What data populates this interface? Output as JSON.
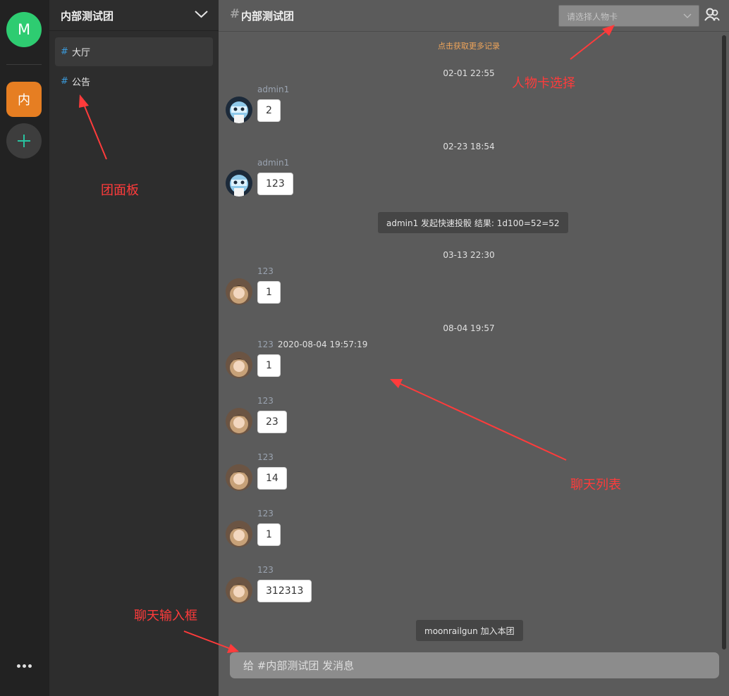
{
  "rail": {
    "user_initial": "M",
    "group_initial": "内",
    "colors": {
      "user": "#2ecc71",
      "group": "#e67e22"
    }
  },
  "panel": {
    "title": "内部测试团",
    "channels": [
      {
        "hash": "#",
        "label": "大厅",
        "active": true
      },
      {
        "hash": "#",
        "label": "公告",
        "active": false
      }
    ]
  },
  "chat": {
    "hash": "#",
    "title": "内部测试团",
    "actor_select_placeholder": "请选择人物卡",
    "load_more": "点击获取更多记录",
    "timestamps": [
      "02-01 22:55",
      "02-23 18:54",
      "03-13 22:30",
      "08-04 19:57"
    ],
    "messages": [
      {
        "name": "admin1",
        "time": "",
        "text": "2",
        "avatar": "robot"
      },
      {
        "name": "admin1",
        "time": "",
        "text": "123",
        "avatar": "robot"
      },
      {
        "name": "123",
        "time": "",
        "text": "1",
        "avatar": "girl"
      },
      {
        "name": "123",
        "time": "2020-08-04 19:57:19",
        "text": "1",
        "avatar": "girl"
      },
      {
        "name": "123",
        "time": "",
        "text": "23",
        "avatar": "girl"
      },
      {
        "name": "123",
        "time": "",
        "text": "14",
        "avatar": "girl"
      },
      {
        "name": "123",
        "time": "",
        "text": "1",
        "avatar": "girl"
      },
      {
        "name": "123",
        "time": "",
        "text": "312313",
        "avatar": "girl"
      }
    ],
    "system_messages": [
      "admin1 发起快速投骰 结果: 1d100=52=52",
      "moonrailgun 加入本团"
    ],
    "input_placeholder": "给 #内部测试团 发消息"
  },
  "annotations": {
    "group_panel": "团面板",
    "actor_select": "人物卡选择",
    "chat_list": "聊天列表",
    "chat_input": "聊天输入框",
    "color": "#ff3b3b"
  },
  "icons": [
    "chevron-down-icon",
    "plus-icon",
    "more-icon",
    "actor-manage-icon",
    "hash-icon"
  ]
}
